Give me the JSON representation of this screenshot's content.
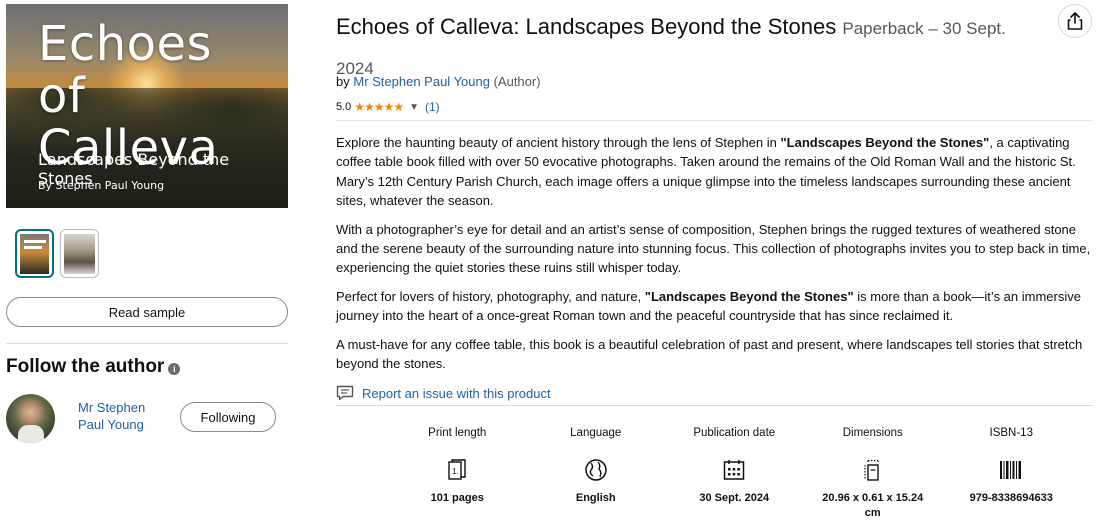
{
  "cover": {
    "title": "Echoes of Calleva",
    "subtitle": "Landscapes Beyond the Stones",
    "author_line": "By Stephen Paul Young"
  },
  "sidebar": {
    "read_sample_label": "Read sample",
    "follow_title": "Follow the author",
    "author_name": "Mr Stephen Paul Young",
    "following_label": "Following"
  },
  "product": {
    "title": "Echoes of Calleva: Landscapes Beyond the Stones",
    "format": "Paperback – 30 Sept. 2024",
    "byline_prefix": "by",
    "author": "Mr Stephen Paul Young",
    "author_role": "(Author)",
    "rating": "5.0",
    "stars": 5,
    "review_count": "(1)",
    "colors": {
      "link": "#2162a1",
      "star": "#f08804",
      "active_thumb": "#007185"
    }
  },
  "description": {
    "p1_before": "Explore the haunting beauty of ancient history through the lens of Stephen in ",
    "p1_bold": "\"Landscapes Beyond the Stones\"",
    "p1_after": ", a captivating coffee table book filled with over 50 evocative photographs. Taken around the remains of the Old Roman Wall and the historic St. Mary’s 12th Century Parish Church, each image offers a unique glimpse into the timeless landscapes surrounding these ancient sites, whatever the season.",
    "p2": "With a photographer’s eye for detail and an artist’s sense of composition, Stephen brings the rugged textures of weathered stone and the serene beauty of the surrounding nature into stunning focus. This collection of photographs invites you to step back in time, experiencing the quiet stories these ruins still whisper today.",
    "p3_before": "Perfect for lovers of history, photography, and nature, ",
    "p3_bold": "\"Landscapes Beyond the Stones\"",
    "p3_after": " is more than a book—it’s an immersive journey into the heart of a once-great Roman town and the peaceful countryside that has since reclaimed it.",
    "p4": "A must-have for any coffee table, this book is a beautiful celebration of past and present, where landscapes tell stories that stretch beyond the stones."
  },
  "report_label": "Report an issue with this product",
  "details": [
    {
      "label": "Print length",
      "value": "101 pages",
      "icon": "pages-icon"
    },
    {
      "label": "Language",
      "value": "English",
      "icon": "globe-icon"
    },
    {
      "label": "Publication date",
      "value": "30 Sept. 2024",
      "icon": "calendar-icon"
    },
    {
      "label": "Dimensions",
      "value": "20.96 x 0.61 x 15.24 cm",
      "icon": "dimensions-icon"
    },
    {
      "label": "ISBN-13",
      "value": "979-8338694633",
      "icon": "barcode-icon"
    }
  ]
}
